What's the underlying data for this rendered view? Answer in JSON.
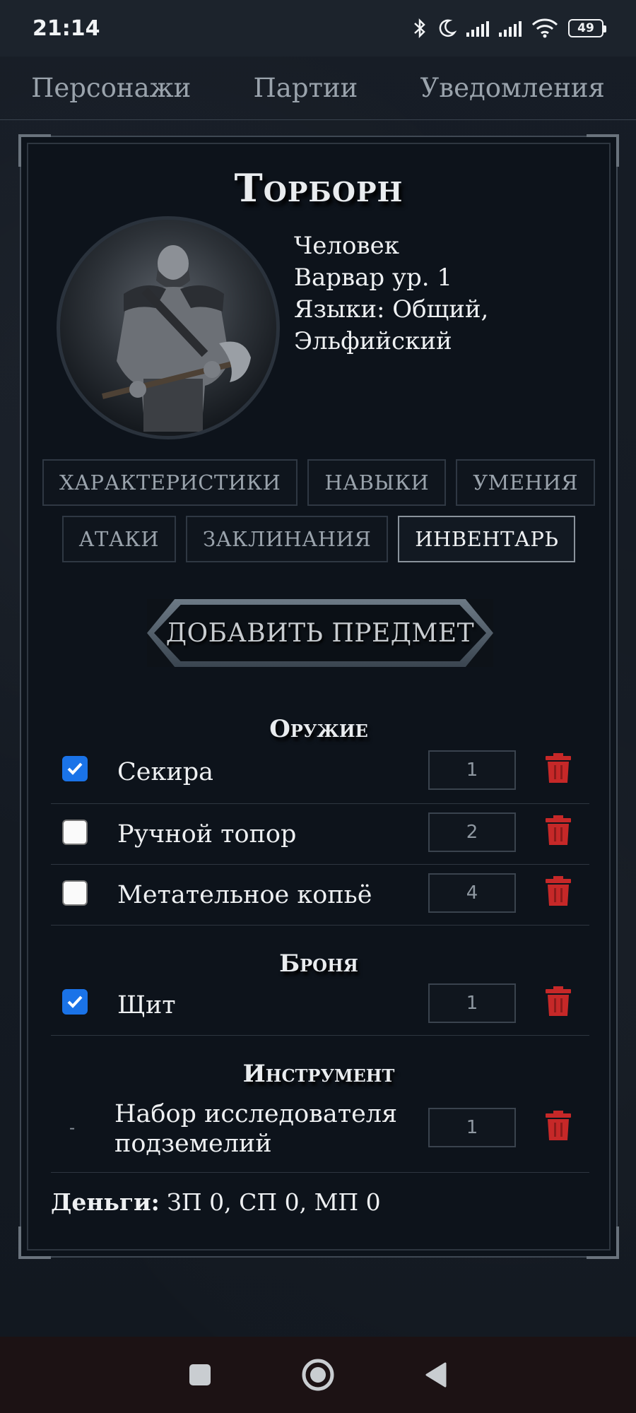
{
  "status_bar": {
    "time": "21:14",
    "battery": "49",
    "icons": [
      "bluetooth-icon",
      "moon-icon",
      "signal-icon",
      "signal-icon",
      "wifi-icon",
      "battery-icon"
    ]
  },
  "top_tabs": [
    {
      "label": "Персонажи"
    },
    {
      "label": "Партии"
    },
    {
      "label": "Уведомления"
    }
  ],
  "character": {
    "name": "Торборн",
    "race": "Человек",
    "class_level": "Варвар ур. 1",
    "languages_line1": "Языки: Общий,",
    "languages_line2": "Эльфийский"
  },
  "sub_tabs": {
    "row1": [
      "ХАРАКТЕРИСТИКИ",
      "НАВЫКИ",
      "УМЕНИЯ"
    ],
    "row2": [
      "АТАКИ",
      "ЗАКЛИНАНИЯ",
      "ИНВЕНТАРЬ"
    ],
    "active": "ИНВЕНТАРЬ"
  },
  "add_item_label": "ДОБАВИТЬ ПРЕДМЕТ",
  "sections": {
    "weapons": {
      "title": "Оружие",
      "items": [
        {
          "name": "Секира",
          "qty": "1",
          "equipped": true
        },
        {
          "name": "Ручной топор",
          "qty": "2",
          "equipped": false
        },
        {
          "name": "Метательное копьё",
          "qty": "4",
          "equipped": false
        }
      ]
    },
    "armor": {
      "title": "Броня",
      "items": [
        {
          "name": "Щит",
          "qty": "1",
          "equipped": true
        }
      ]
    },
    "tools": {
      "title": "Инструмент",
      "items": [
        {
          "name_line1": "Набор исследователя",
          "name_line2": "подземелий",
          "qty": "1",
          "marker": "-"
        }
      ]
    }
  },
  "money": {
    "label": "Деньги:",
    "value": "ЗП 0, СП 0, МП 0"
  },
  "colors": {
    "accent_check": "#1a73e8",
    "trash": "#c62828",
    "card_bg": "#0d131b"
  }
}
